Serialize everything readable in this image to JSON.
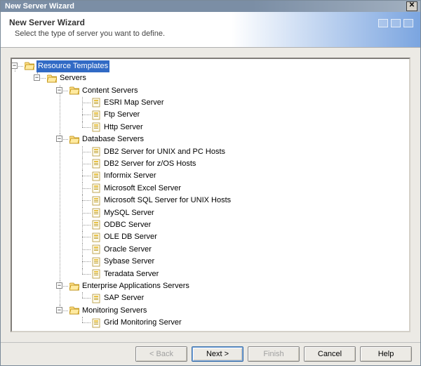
{
  "window": {
    "title": "New Server Wizard"
  },
  "header": {
    "title": "New Server Wizard",
    "subtitle": "Select the type of server you want to define."
  },
  "tree": {
    "root": {
      "label": "Resource Templates",
      "expanded": true,
      "selected": true,
      "children": [
        {
          "label": "Servers",
          "expanded": true,
          "children": [
            {
              "label": "Content Servers",
              "expanded": true,
              "children": [
                {
                  "label": "ESRI Map Server",
                  "leaf": true
                },
                {
                  "label": "Ftp Server",
                  "leaf": true
                },
                {
                  "label": "Http Server",
                  "leaf": true
                }
              ]
            },
            {
              "label": "Database Servers",
              "expanded": true,
              "children": [
                {
                  "label": "DB2 Server for UNIX and PC Hosts",
                  "leaf": true
                },
                {
                  "label": "DB2 Server for z/OS Hosts",
                  "leaf": true
                },
                {
                  "label": "Informix Server",
                  "leaf": true
                },
                {
                  "label": "Microsoft Excel Server",
                  "leaf": true
                },
                {
                  "label": "Microsoft SQL Server for UNIX Hosts",
                  "leaf": true
                },
                {
                  "label": "MySQL Server",
                  "leaf": true
                },
                {
                  "label": "ODBC Server",
                  "leaf": true
                },
                {
                  "label": "OLE DB Server",
                  "leaf": true
                },
                {
                  "label": "Oracle Server",
                  "leaf": true
                },
                {
                  "label": "Sybase Server",
                  "leaf": true
                },
                {
                  "label": "Teradata Server",
                  "leaf": true
                }
              ]
            },
            {
              "label": "Enterprise Applications Servers",
              "expanded": true,
              "children": [
                {
                  "label": "SAP Server",
                  "leaf": true
                }
              ]
            },
            {
              "label": "Monitoring Servers",
              "expanded": true,
              "children": [
                {
                  "label": "Grid Monitoring Server",
                  "leaf": true
                }
              ]
            }
          ]
        }
      ]
    }
  },
  "buttons": {
    "back": "< Back",
    "next": "Next >",
    "finish": "Finish",
    "cancel": "Cancel",
    "help": "Help"
  },
  "button_state": {
    "back_enabled": false,
    "next_enabled": true,
    "finish_enabled": false,
    "cancel_enabled": true,
    "help_enabled": true
  }
}
